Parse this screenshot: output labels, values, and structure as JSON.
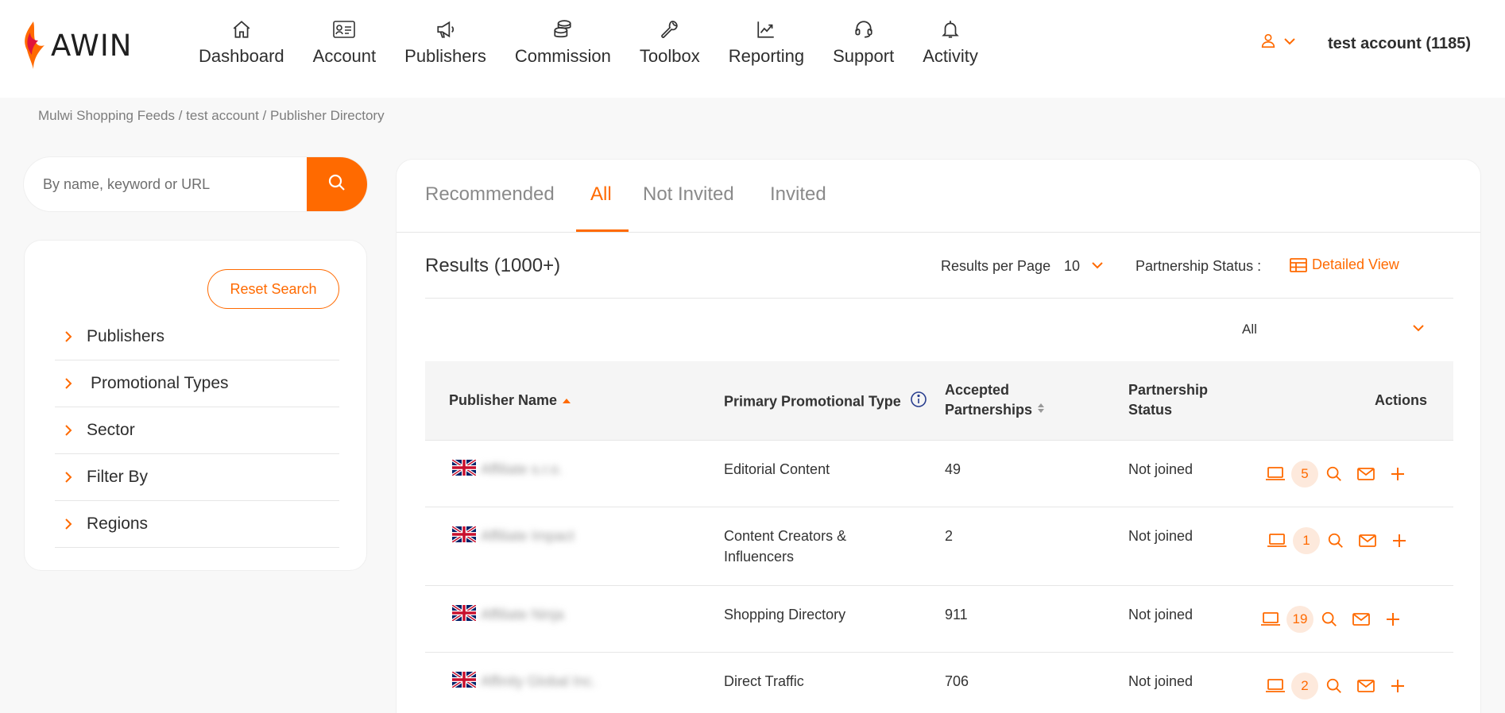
{
  "brand": {
    "name": "AWIN",
    "accent": "#ff6a00"
  },
  "nav": {
    "items": [
      {
        "label": "Dashboard",
        "icon": "home-icon"
      },
      {
        "label": "Account",
        "icon": "id-card-icon"
      },
      {
        "label": "Publishers",
        "icon": "megaphone-icon"
      },
      {
        "label": "Commission",
        "icon": "coins-icon"
      },
      {
        "label": "Toolbox",
        "icon": "wrench-icon"
      },
      {
        "label": "Reporting",
        "icon": "chart-icon"
      },
      {
        "label": "Support",
        "icon": "headset-icon"
      },
      {
        "label": "Activity",
        "icon": "bell-icon"
      }
    ],
    "user_name": "test account (1185)"
  },
  "breadcrumb": "Mulwi Shopping Feeds / test account / Publisher Directory",
  "search": {
    "placeholder": "By name, keyword or URL",
    "value": ""
  },
  "filters": {
    "reset_label": "Reset Search",
    "items": [
      "Publishers",
      "Promotional Types",
      "Sector",
      "Filter By",
      "Regions"
    ]
  },
  "tabs": [
    "Recommended",
    "All",
    "Not Invited",
    "Invited"
  ],
  "active_tab": "All",
  "results": {
    "title": "Results (1000+)",
    "per_page_label": "Results per Page",
    "per_page_value": "10",
    "partnership_status_label": "Partnership Status :",
    "detailed_view_label": "Detailed View",
    "status_filter_value": "All"
  },
  "table": {
    "headers": {
      "publisher_name": "Publisher Name",
      "primary_type": "Primary Promotional Type",
      "accepted_1": "Accepted",
      "accepted_2": "Partnerships",
      "status_1": "Partnership",
      "status_2": "Status",
      "actions": "Actions"
    },
    "rows": [
      {
        "name": "Affiliate s.r.o.",
        "type_1": "Editorial Content",
        "type_2": "",
        "accepted": "49",
        "status": "Not joined",
        "sites": "5"
      },
      {
        "name": "Affiliate Impact",
        "type_1": "Content Creators &",
        "type_2": "Influencers",
        "accepted": "2",
        "status": "Not joined",
        "sites": "1"
      },
      {
        "name": "Affiliate Ninja",
        "type_1": "Shopping Directory",
        "type_2": "",
        "accepted": "911",
        "status": "Not joined",
        "sites": "19"
      },
      {
        "name": "Affinity Global Inc.",
        "type_1": "Direct Traffic",
        "type_2": "",
        "accepted": "706",
        "status": "Not joined",
        "sites": "2"
      }
    ]
  }
}
